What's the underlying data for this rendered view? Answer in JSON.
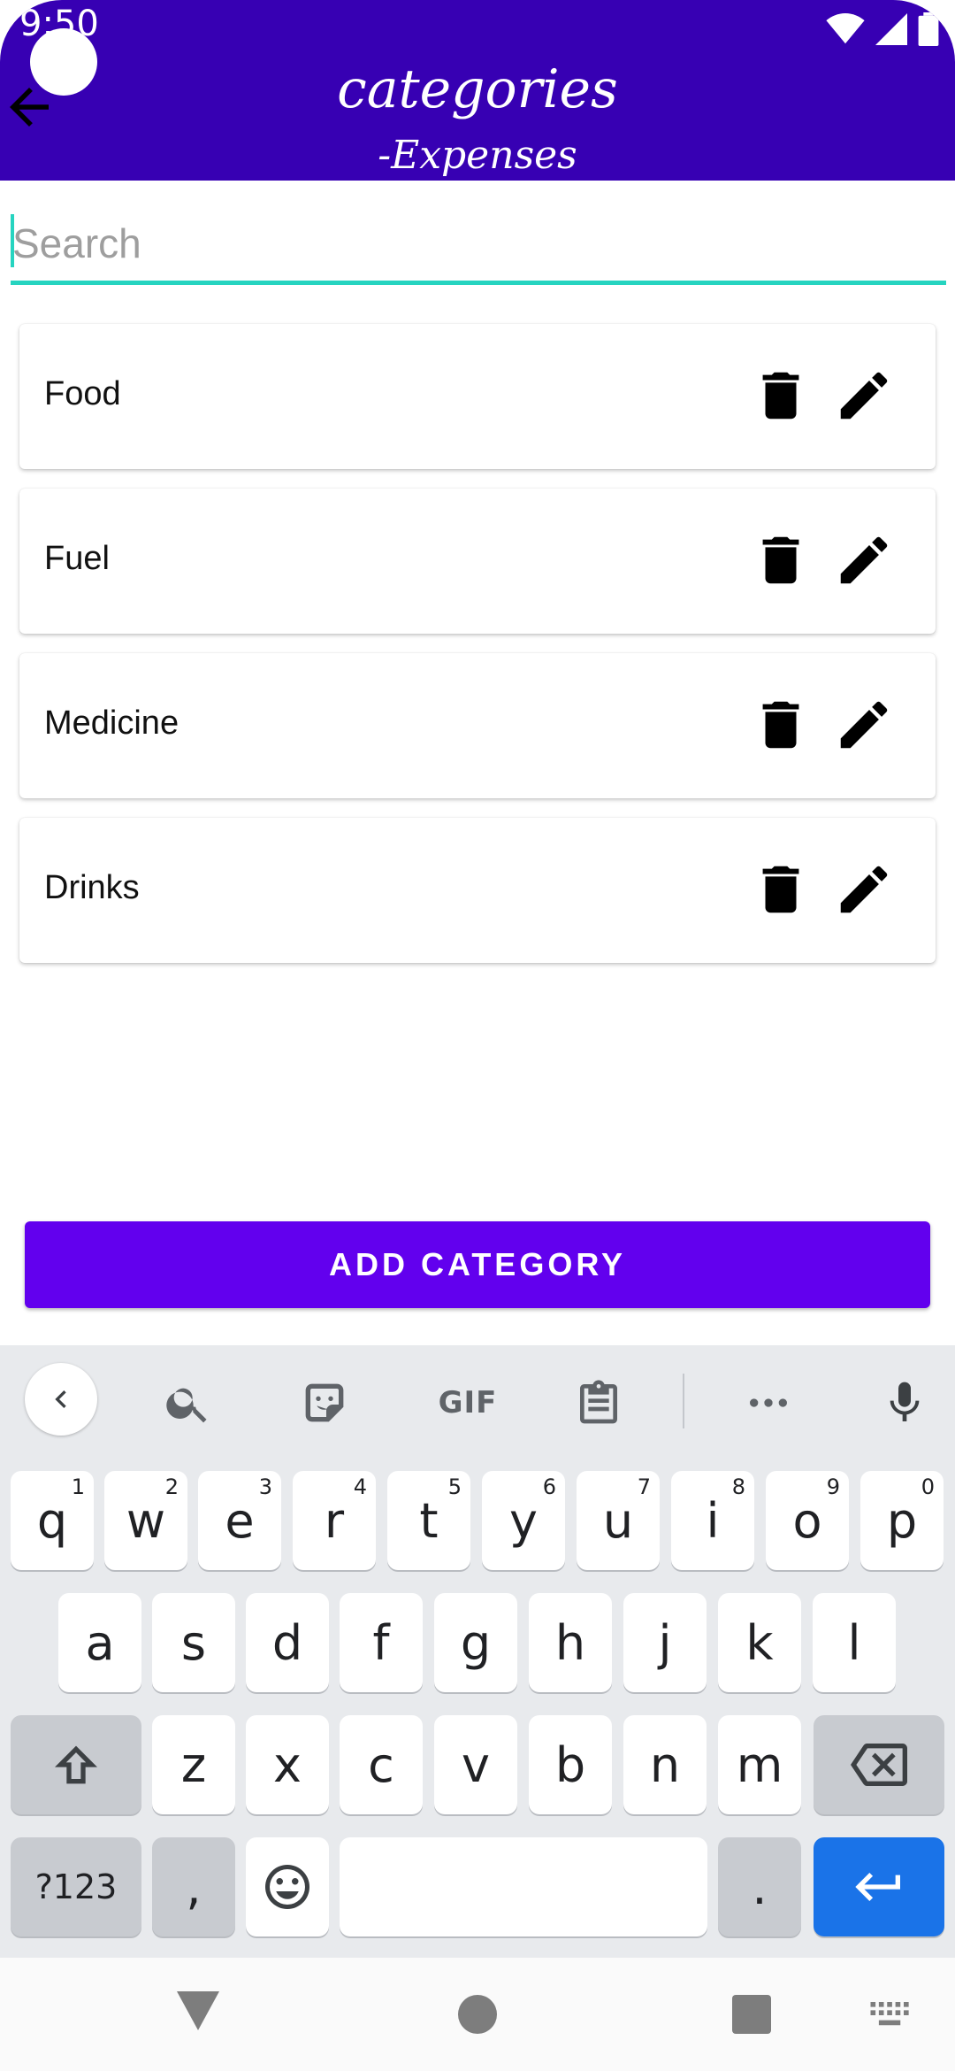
{
  "status": {
    "time": "9:50"
  },
  "appbar": {
    "title": "categories",
    "subtitle": "-Expenses",
    "color": "#3700b3"
  },
  "search": {
    "placeholder": "Search",
    "value": ""
  },
  "categories": [
    {
      "label": "Food"
    },
    {
      "label": "Fuel"
    },
    {
      "label": "Medicine"
    },
    {
      "label": "Drinks"
    }
  ],
  "actions": {
    "add_label": "ADD CATEGORY",
    "color": "#6200ee"
  },
  "keyboard": {
    "toolbar": [
      "back-arrow-icon",
      "search-icon",
      "sticker-icon",
      "GIF",
      "clipboard-icon",
      "more-icon",
      "microphone-icon"
    ],
    "gif_label": "GIF",
    "row1": [
      {
        "k": "q",
        "h": "1"
      },
      {
        "k": "w",
        "h": "2"
      },
      {
        "k": "e",
        "h": "3"
      },
      {
        "k": "r",
        "h": "4"
      },
      {
        "k": "t",
        "h": "5"
      },
      {
        "k": "y",
        "h": "6"
      },
      {
        "k": "u",
        "h": "7"
      },
      {
        "k": "i",
        "h": "8"
      },
      {
        "k": "o",
        "h": "9"
      },
      {
        "k": "p",
        "h": "0"
      }
    ],
    "row2": [
      "a",
      "s",
      "d",
      "f",
      "g",
      "h",
      "j",
      "k",
      "l"
    ],
    "row3": [
      "z",
      "x",
      "c",
      "v",
      "b",
      "n",
      "m"
    ],
    "symbols_label": "?123",
    "comma": ",",
    "period": "."
  }
}
